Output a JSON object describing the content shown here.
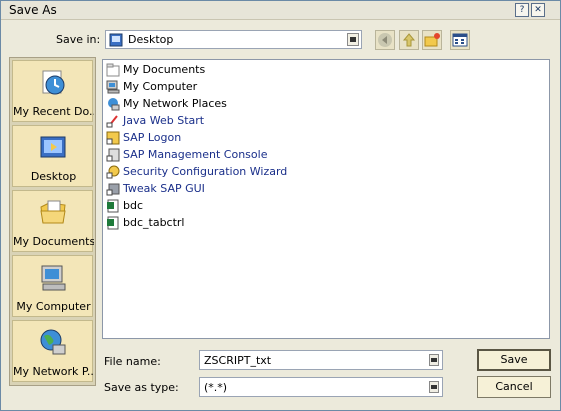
{
  "window": {
    "title": "Save As",
    "help_glyph": "?",
    "close_glyph": "✕"
  },
  "save_in": {
    "label": "Save in:",
    "value": "Desktop"
  },
  "toolbar": {
    "buttons": [
      "back-icon",
      "up-folder-icon",
      "new-folder-icon",
      "view-menu-icon"
    ]
  },
  "places": [
    {
      "label": "My Recent Do...",
      "icon": "recent-documents-icon"
    },
    {
      "label": "Desktop",
      "icon": "desktop-icon"
    },
    {
      "label": "My Documents",
      "icon": "my-documents-icon"
    },
    {
      "label": "My Computer",
      "icon": "my-computer-icon"
    },
    {
      "label": "My Network P...",
      "icon": "network-places-icon"
    }
  ],
  "files": [
    {
      "name": "My Documents",
      "icon": "folder-icon",
      "color": "#000000"
    },
    {
      "name": "My Computer",
      "icon": "computer-icon",
      "color": "#000000"
    },
    {
      "name": "My Network Places",
      "icon": "network-icon",
      "color": "#000000"
    },
    {
      "name": "Java Web Start",
      "icon": "shortcut-java-icon",
      "color": "#1a2f8a"
    },
    {
      "name": "SAP Logon",
      "icon": "shortcut-sap-icon",
      "color": "#1a2f8a"
    },
    {
      "name": "SAP Management Console",
      "icon": "shortcut-console-icon",
      "color": "#1a2f8a"
    },
    {
      "name": "Security Configuration Wizard",
      "icon": "shortcut-wizard-icon",
      "color": "#1a2f8a"
    },
    {
      "name": "Tweak SAP GUI",
      "icon": "shortcut-tweak-icon",
      "color": "#1a2f8a"
    },
    {
      "name": "bdc",
      "icon": "excel-file-icon",
      "color": "#000000"
    },
    {
      "name": "bdc_tabctrl",
      "icon": "excel-file-icon",
      "color": "#000000"
    }
  ],
  "file_name": {
    "label": "File name:",
    "value": "ZSCRIPT_txt"
  },
  "save_as_type": {
    "label": "Save as type:",
    "value": "(*.*)"
  },
  "buttons": {
    "save": "Save",
    "cancel": "Cancel"
  }
}
